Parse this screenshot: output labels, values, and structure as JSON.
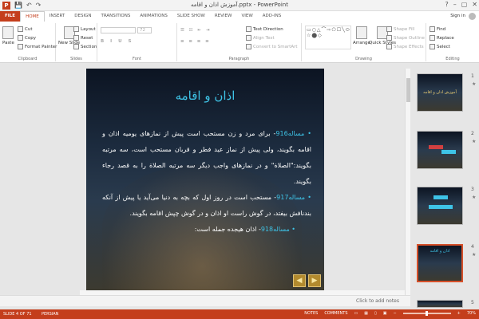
{
  "window": {
    "title": "آموزش اذان و اقامه.pptx - PowerPoint",
    "app_icon": "P"
  },
  "qat": {
    "save_icon": "save-icon",
    "undo_icon": "undo-icon",
    "redo_icon": "redo-icon"
  },
  "tabs": [
    "FILE",
    "HOME",
    "INSERT",
    "DESIGN",
    "TRANSITIONS",
    "ANIMATIONS",
    "SLIDE SHOW",
    "REVIEW",
    "VIEW",
    "ADD-INS"
  ],
  "signin": "Sign in",
  "ribbon": {
    "clipboard": {
      "paste": "Paste",
      "cut": "Cut",
      "copy": "Copy",
      "format_painter": "Format Painter",
      "label": "Clipboard"
    },
    "slides": {
      "new_slide": "New Slide",
      "layout": "Layout",
      "reset": "Reset",
      "section": "Section",
      "label": "Slides"
    },
    "font": {
      "size": "72",
      "label": "Font"
    },
    "paragraph": {
      "text_direction": "Text Direction",
      "align_text": "Align Text",
      "convert_smartart": "Convert to SmartArt",
      "label": "Paragraph"
    },
    "drawing": {
      "arrange": "Arrange",
      "quick_styles": "Quick Styles",
      "shape_fill": "Shape Fill",
      "shape_outline": "Shape Outline",
      "shape_effects": "Shape Effects",
      "label": "Drawing"
    },
    "editing": {
      "find": "Find",
      "replace": "Replace",
      "select": "Select",
      "label": "Editing"
    }
  },
  "slide": {
    "title": "اذان و اقامه",
    "paragraphs": [
      {
        "highlight": "مساله916",
        "text": "- برای مرد و زن مستحب است پیش از نمازهای یومیه اذان و اقامه بگویند، ولی پیش از نماز عید فطر و قربان مستحب است، سه مرتبه بگویند:\"الصلاة\" و در نمازهای واجب دیگر سه مرتبه الصلاة را به قصد رجاء بگویند."
      },
      {
        "highlight": "مساله917",
        "text": "- مستحب است در روز اول که بچه به دنیا می‌آید یا پیش از آنکه بندنافش بیفتد، در گوش راست او اذان و در گوش چپش اقامه بگویند."
      },
      {
        "highlight": "مساله918",
        "text": "- اذان هیجده جمله است:"
      }
    ]
  },
  "thumbnails": [
    {
      "num": "1",
      "title": "آموزش اذان و اقامه"
    },
    {
      "num": "2",
      "title": ""
    },
    {
      "num": "3",
      "title": ""
    },
    {
      "num": "4",
      "title": "اذان و اقامه"
    },
    {
      "num": "5",
      "title": ""
    }
  ],
  "notes_placeholder": "Click to add notes",
  "status": {
    "slide": "SLIDE 4 OF 71",
    "language": "PERSIAN",
    "notes": "NOTES",
    "comments": "COMMENTS",
    "zoom": "70%"
  }
}
